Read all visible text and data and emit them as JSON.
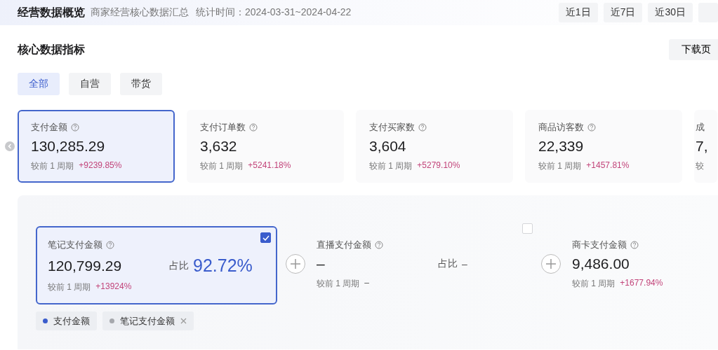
{
  "header": {
    "title": "经营数据概览",
    "subtitle": "商家经营核心数据汇总",
    "period": "统计时间：2024-03-31~2024-04-22",
    "ranges": [
      {
        "label": "近1日",
        "selected": false
      },
      {
        "label": "近7日",
        "selected": false
      },
      {
        "label": "近30日",
        "selected": false
      }
    ]
  },
  "section": {
    "title": "核心数据指标",
    "download": "下载页"
  },
  "tabs": [
    {
      "label": "全部",
      "selected": true
    },
    {
      "label": "自营",
      "selected": false
    },
    {
      "label": "带货",
      "selected": false
    }
  ],
  "metrics": [
    {
      "label": "支付金额",
      "value": "130,285.29",
      "compare": "较前 1 周期",
      "change": "+9239.85%",
      "selected": true
    },
    {
      "label": "支付订单数",
      "value": "3,632",
      "compare": "较前 1 周期",
      "change": "+5241.18%",
      "selected": false
    },
    {
      "label": "支付买家数",
      "value": "3,604",
      "compare": "较前 1 周期",
      "change": "+5279.10%",
      "selected": false
    },
    {
      "label": "商品访客数",
      "value": "22,339",
      "compare": "较前 1 周期",
      "change": "+1457.81%",
      "selected": false
    },
    {
      "label": "成",
      "value": "7,",
      "compare": "较",
      "selected": false
    }
  ],
  "breakdown": [
    {
      "label": "笔记支付金额",
      "value": "120,799.29",
      "share_label": "占比",
      "share": "92.72%",
      "compare": "较前 1 周期",
      "change": "+13924%",
      "checked": true
    },
    {
      "label": "直播支付金额",
      "value": "–",
      "share_label": "占比",
      "share": "–",
      "compare": "较前 1 周期",
      "change": "–",
      "checked": false
    },
    {
      "label": "商卡支付金额",
      "value": "9,486.00",
      "compare": "较前 1 周期",
      "change": "+1677.94%"
    }
  ],
  "legend": [
    {
      "label": "支付金额",
      "color": "#3a5ccc",
      "removable": false
    },
    {
      "label": "笔记支付金额",
      "color": "#a6a8ad",
      "removable": true
    }
  ]
}
